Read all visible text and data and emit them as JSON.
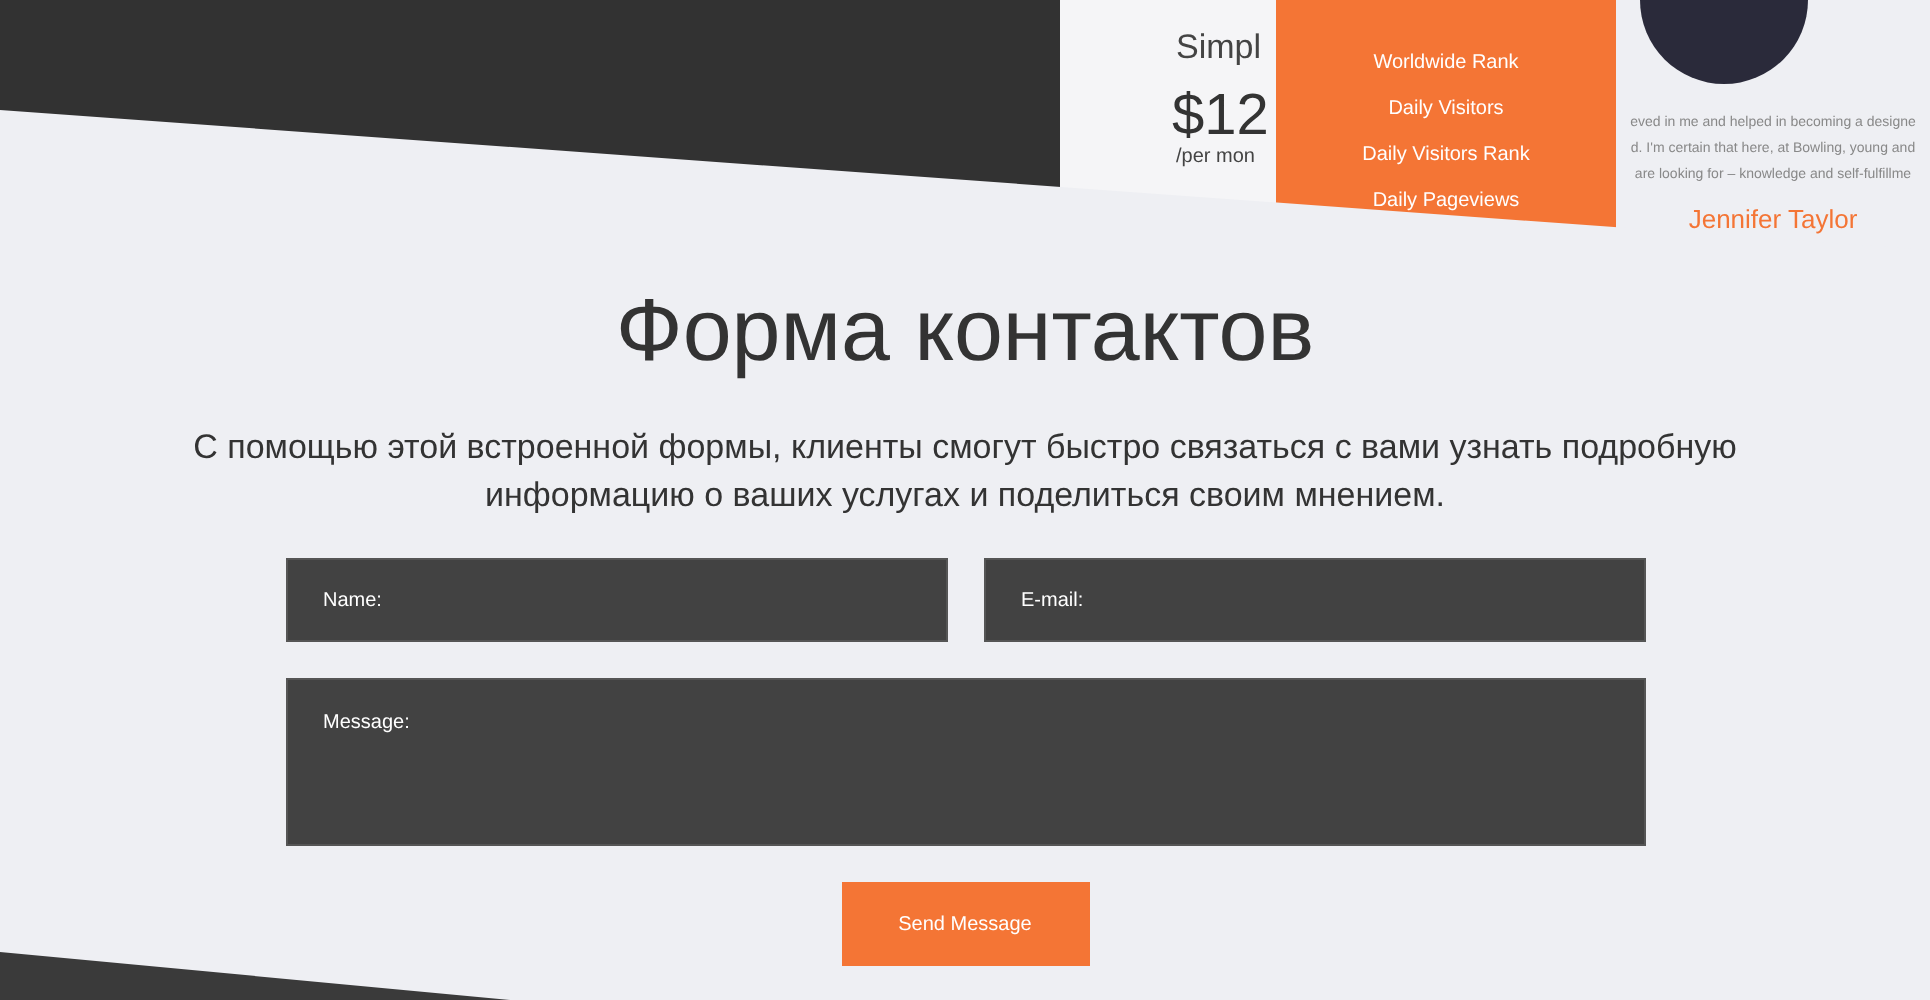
{
  "pricing_card": {
    "title": "Simpl",
    "price": "$12",
    "period": "/per mon"
  },
  "feature_list": {
    "items": [
      "Worldwide Rank",
      "Daily Visitors",
      "Daily Visitors Rank",
      "Daily Pageviews"
    ]
  },
  "testimonial": {
    "lines": [
      "eved in me and helped in becoming a designe",
      "d. I'm certain that here, at Bowling, young and",
      "are looking for – knowledge and self-fulfillme"
    ],
    "name": "Jennifer Taylor"
  },
  "contact": {
    "title": "Форма контактов",
    "description": "С помощью этой встроенной формы, клиенты смогут быстро связаться с вами узнать подробную информацию о ваших услугах и поделиться своим мнением.",
    "name_field": {
      "placeholder": "Name:"
    },
    "email_field": {
      "placeholder": "E-mail:"
    },
    "message_field": {
      "placeholder": "Message:"
    },
    "submit": "Send Message"
  }
}
